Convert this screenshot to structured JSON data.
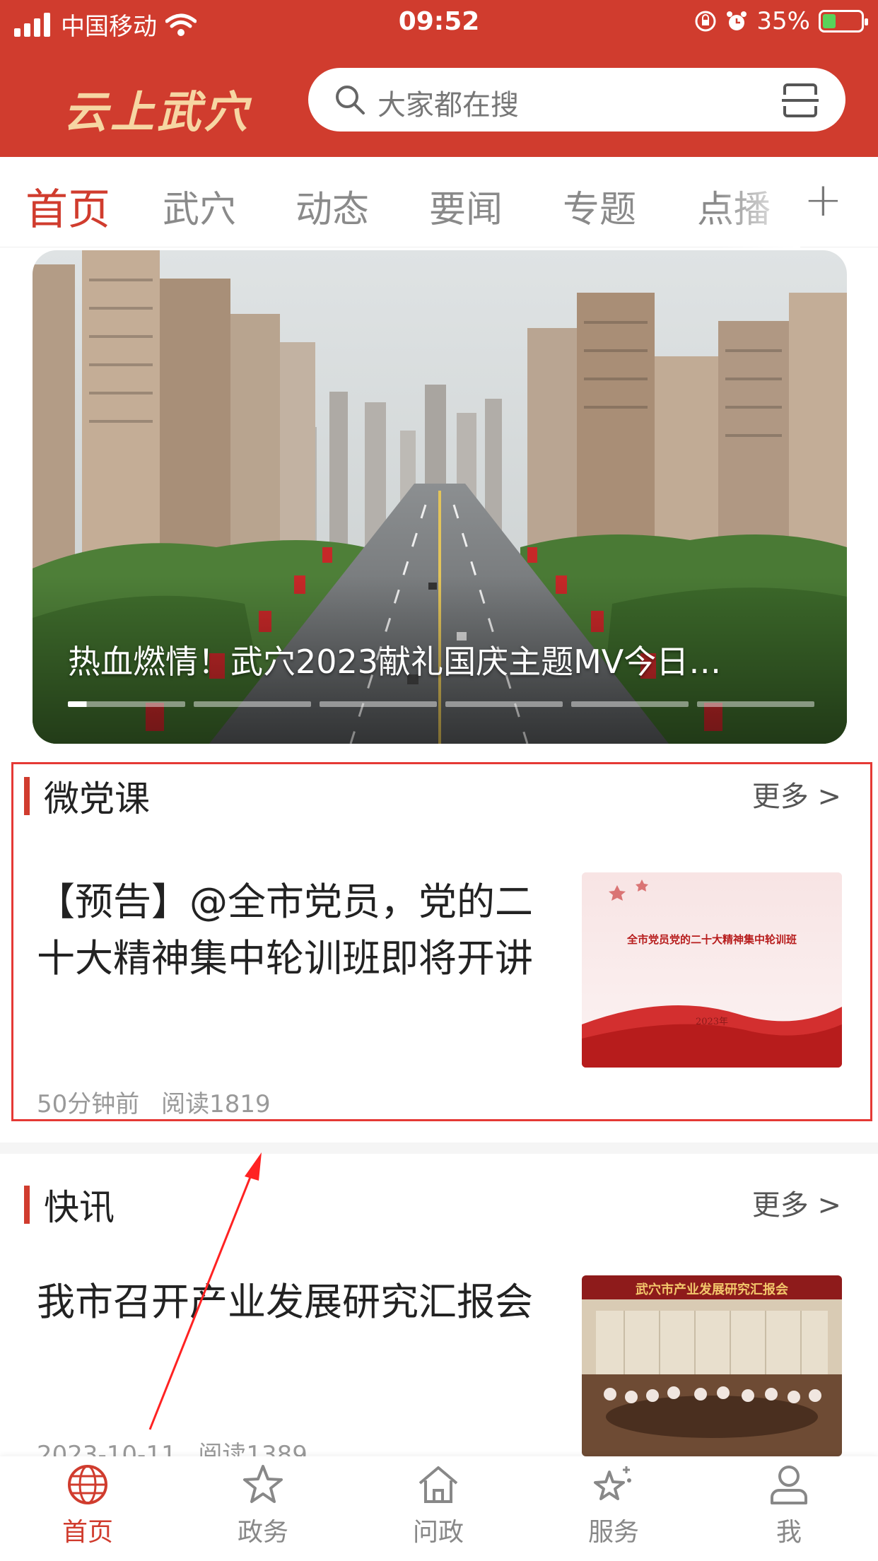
{
  "status_bar": {
    "carrier": "中国移动",
    "time": "09:52",
    "battery": "35%",
    "battery_level": 0.35,
    "icons": [
      "signal-icon",
      "wifi-icon",
      "rotation-lock-icon",
      "alarm-icon",
      "battery-charging-icon"
    ]
  },
  "header": {
    "logo_text": "云上武穴",
    "search_placeholder": "大家都在搜",
    "colors": {
      "brand": "#d03c2e",
      "logo": "#f6d6a3"
    }
  },
  "tabs": {
    "items": [
      "首页",
      "武穴",
      "动态",
      "要闻",
      "专题",
      "点播"
    ],
    "active": "首页",
    "add_label": "+"
  },
  "hero": {
    "caption": "热血燃情！武穴2023献礼国庆主题MV今日…",
    "slide_count": 6,
    "active_slide": 1,
    "progress": 0.16
  },
  "section_party": {
    "title": "微党课",
    "more": "更多 >",
    "article": {
      "title": "【预告】@全市党员，党的二十大精神集中轮训班即将开讲",
      "time": "50分钟前",
      "reads": "阅读1819",
      "thumb_title": "全市党员党的二十大精神集中轮训班",
      "thumb_year": "2023年"
    }
  },
  "section_news": {
    "title": "快讯",
    "more": "更多 >",
    "article": {
      "title": "我市召开产业发展研究汇报会",
      "time": "2023-10-11",
      "reads": "阅读1389",
      "thumb_banner": "武穴市产业发展研究汇报会"
    }
  },
  "bottom_nav": {
    "items": [
      {
        "label": "首页",
        "icon": "globe-icon"
      },
      {
        "label": "政务",
        "icon": "star-icon"
      },
      {
        "label": "问政",
        "icon": "home-icon"
      },
      {
        "label": "服务",
        "icon": "sparkle-star-icon"
      },
      {
        "label": "我",
        "icon": "user-icon"
      }
    ],
    "active": "首页"
  }
}
